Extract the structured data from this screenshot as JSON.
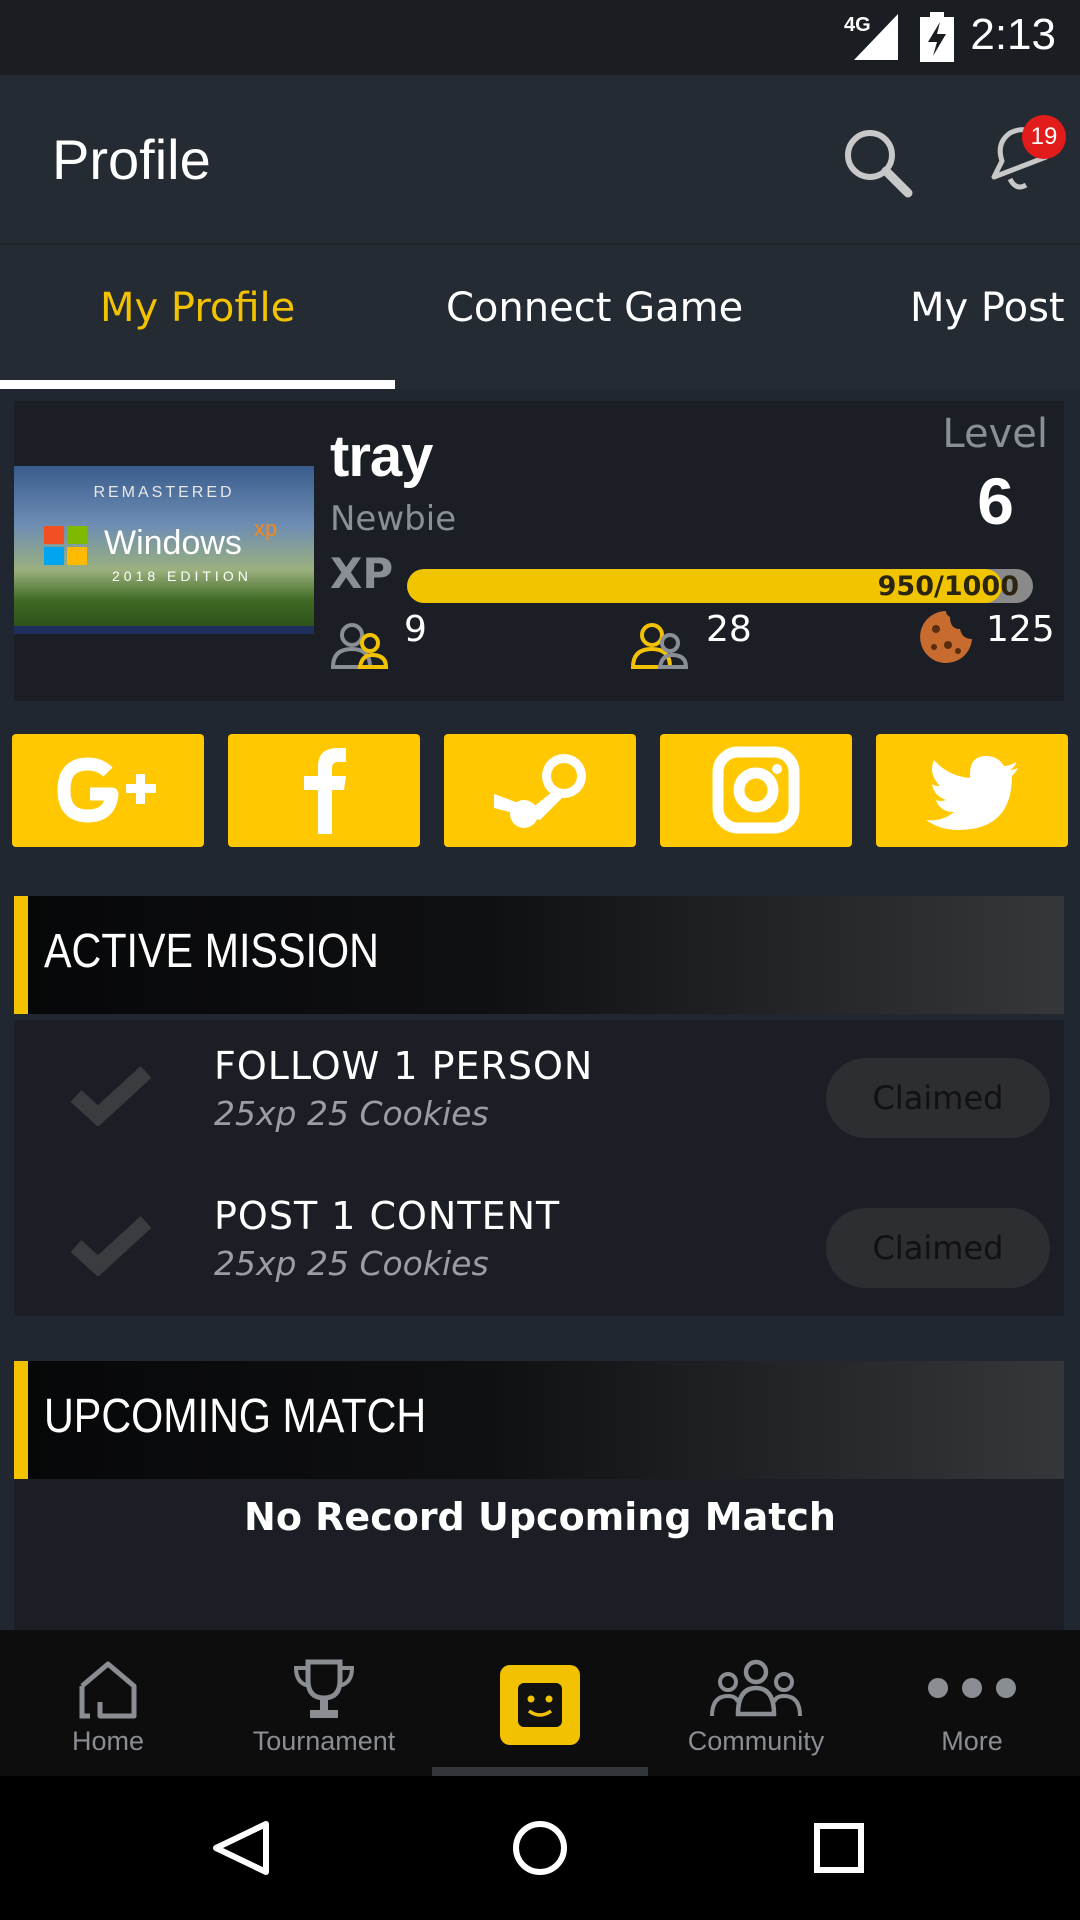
{
  "status_bar": {
    "network": "4G",
    "time": "2:13"
  },
  "app_bar": {
    "title": "Profile",
    "notification_count": "19"
  },
  "tabs": [
    {
      "label": "My Profile",
      "active": true
    },
    {
      "label": "Connect Game",
      "active": false
    },
    {
      "label": "My Post",
      "active": false
    }
  ],
  "profile": {
    "cover": {
      "line1": "REMASTERED",
      "brand": "Windows",
      "brand_sup": "xp",
      "line3": "2018 EDITION"
    },
    "username": "tray",
    "rank": "Newbie",
    "level_label": "Level",
    "level_value": "6",
    "xp_label": "XP",
    "xp_text": "950/1000",
    "xp_progress": 0.95,
    "followers": "9",
    "following": "28",
    "cookies": "125"
  },
  "social_buttons": [
    {
      "icon": "google-plus-icon"
    },
    {
      "icon": "facebook-icon"
    },
    {
      "icon": "steam-icon"
    },
    {
      "icon": "instagram-icon"
    },
    {
      "icon": "twitter-icon"
    }
  ],
  "active_mission": {
    "header": "ACTIVE MISSION",
    "items": [
      {
        "title": "FOLLOW 1 PERSON",
        "reward": "25xp 25 Cookies",
        "status": "Claimed"
      },
      {
        "title": "POST 1 CONTENT",
        "reward": "25xp 25 Cookies",
        "status": "Claimed"
      }
    ]
  },
  "upcoming_match": {
    "header": "UPCOMING MATCH",
    "empty_text": "No Record Upcoming Match"
  },
  "bottom_nav": [
    {
      "label": "Home",
      "icon": "home-icon"
    },
    {
      "label": "Tournament",
      "icon": "trophy-icon"
    },
    {
      "label": "",
      "icon": "profile-face-icon",
      "active": true
    },
    {
      "label": "Community",
      "icon": "community-icon"
    },
    {
      "label": "More",
      "icon": "more-dots-icon"
    }
  ],
  "colors": {
    "accent": "#f2c200",
    "social_bg": "#ffc800",
    "badge": "#e21b1b",
    "panel": "#1b1f25",
    "background": "#202730"
  }
}
